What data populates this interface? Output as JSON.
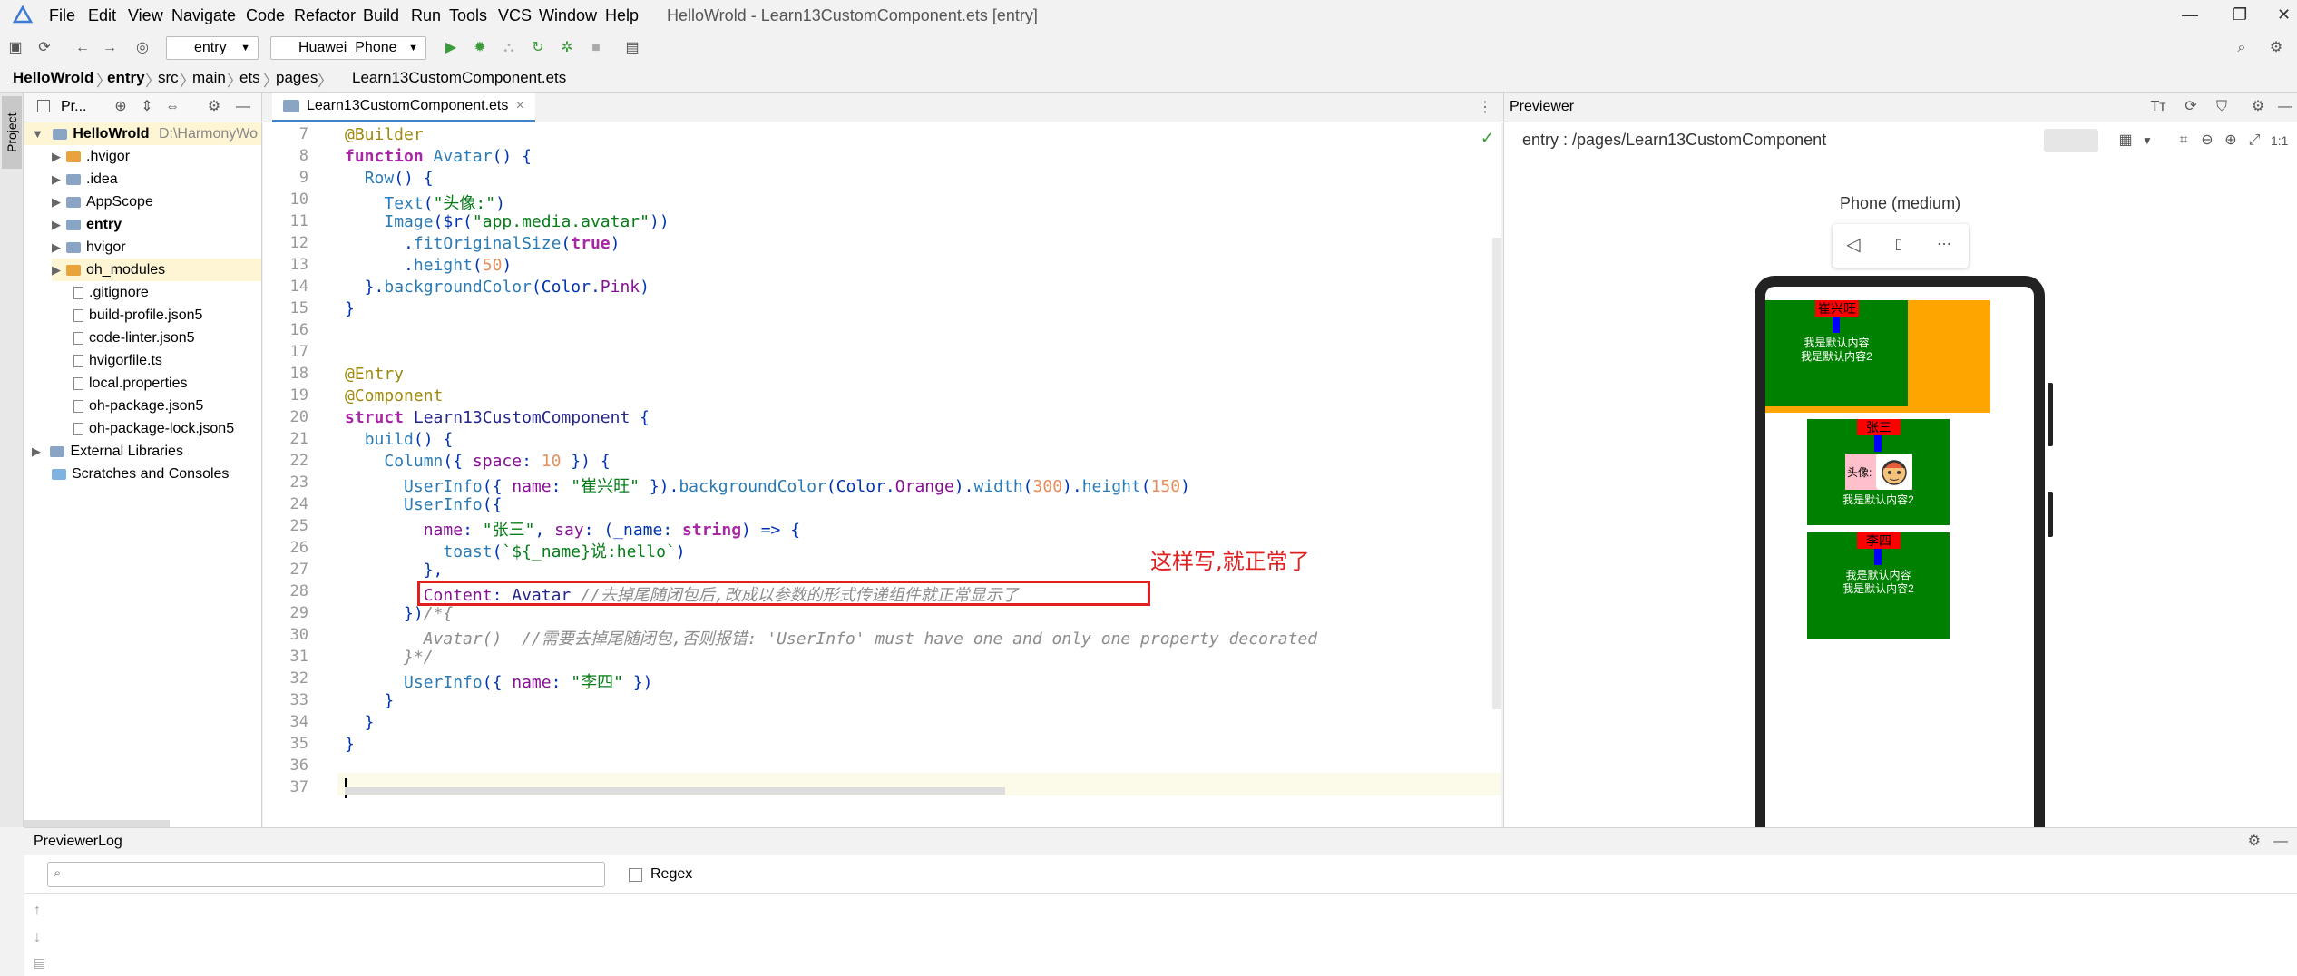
{
  "app": {
    "window_title": "HelloWrold - Learn13CustomComponent.ets [entry]",
    "menu": [
      "File",
      "Edit",
      "View",
      "Navigate",
      "Code",
      "Refactor",
      "Build",
      "Run",
      "Tools",
      "VCS",
      "Window",
      "Help"
    ]
  },
  "toolbar": {
    "module_select": "entry",
    "device_select": "Huawei_Phone"
  },
  "breadcrumb": [
    "HelloWrold",
    "entry",
    "src",
    "main",
    "ets",
    "pages",
    "Learn13CustomComponent.ets"
  ],
  "project": {
    "header": "Pr...",
    "root_name": "HelloWrold",
    "root_path": "D:\\HarmonyWo",
    "items": [
      {
        "label": ".hvigor",
        "type": "folder",
        "color": "#e8a33d"
      },
      {
        "label": ".idea",
        "type": "folder",
        "color": "#8aa4c4"
      },
      {
        "label": "AppScope",
        "type": "folder",
        "color": "#8aa4c4"
      },
      {
        "label": "entry",
        "type": "folder",
        "color": "#8aa4c4"
      },
      {
        "label": "hvigor",
        "type": "folder",
        "color": "#8aa4c4"
      },
      {
        "label": "oh_modules",
        "type": "folder",
        "color": "#e8a33d"
      },
      {
        "label": ".gitignore",
        "type": "file"
      },
      {
        "label": "build-profile.json5",
        "type": "file"
      },
      {
        "label": "code-linter.json5",
        "type": "file"
      },
      {
        "label": "hvigorfile.ts",
        "type": "file"
      },
      {
        "label": "local.properties",
        "type": "file"
      },
      {
        "label": "oh-package.json5",
        "type": "file"
      },
      {
        "label": "oh-package-lock.json5",
        "type": "file"
      }
    ],
    "external_libraries": "External Libraries",
    "scratches": "Scratches and Consoles"
  },
  "editor": {
    "tab_label": "Learn13CustomComponent.ets",
    "line_numbers": [
      "7",
      "8",
      "9",
      "10",
      "11",
      "12",
      "13",
      "14",
      "15",
      "16",
      "17",
      "18",
      "19",
      "20",
      "21",
      "22",
      "23",
      "24",
      "25",
      "26",
      "27",
      "28",
      "29",
      "30",
      "31",
      "32",
      "33",
      "34",
      "35",
      "36",
      "37"
    ],
    "annotation_text": "这样写,就正常了"
  },
  "previewer": {
    "title": "Previewer",
    "path": "entry : /pages/Learn13CustomComponent",
    "device_label": "Phone (medium)",
    "card1": {
      "name": "崔兴旺",
      "line1": "我是默认内容",
      "line2": "我是默认内容2"
    },
    "card2": {
      "name": "张三",
      "avatar_label": "头像:",
      "line1": "我是默认内容2"
    },
    "card3": {
      "name": "李四",
      "line1": "我是默认内容",
      "line2": "我是默认内容2"
    }
  },
  "log": {
    "title": "PreviewerLog",
    "regex_label": "Regex"
  },
  "colors": {
    "accent": "#4083c9",
    "highlight_box": "#e02020",
    "green": "#008000",
    "orange": "#ffa500",
    "pink": "#ffc0cb",
    "blue": "#0000ff",
    "red": "#ff0000"
  }
}
